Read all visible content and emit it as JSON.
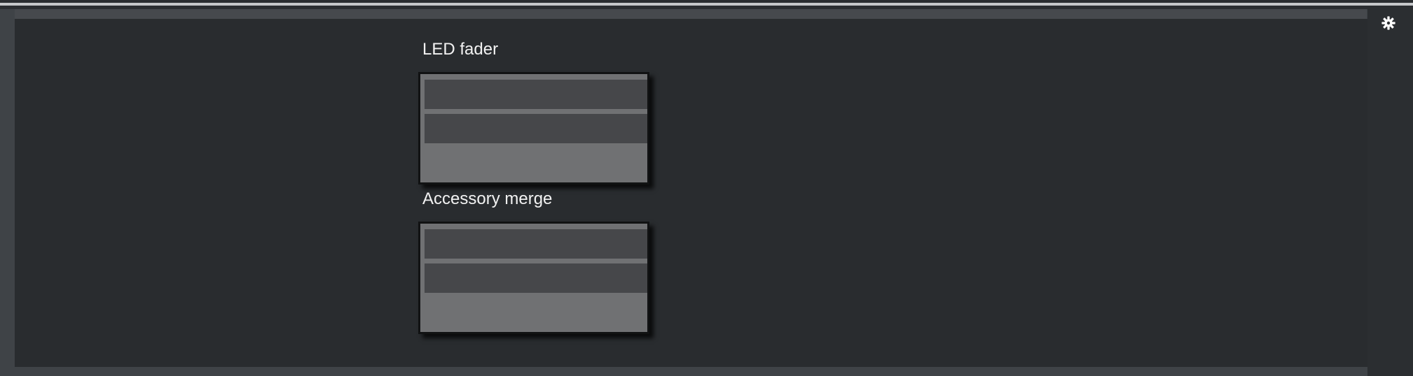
{
  "toolbar": {
    "settings_icon": "gear-icon"
  },
  "widgets": [
    {
      "title": "LED fader",
      "rows": [
        "",
        ""
      ]
    },
    {
      "title": "Accessory merge",
      "rows": [
        "",
        ""
      ]
    }
  ],
  "colors": {
    "background": "#292c2f",
    "frame": "#3f4347",
    "widget_fill": "#707173",
    "row_fill": "#46474a",
    "text": "#f2f2f2"
  }
}
